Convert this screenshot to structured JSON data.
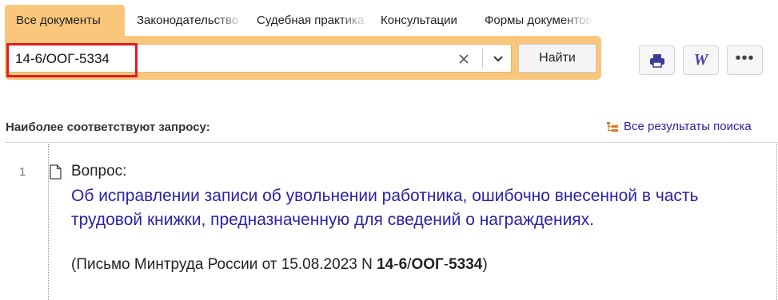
{
  "tabs": [
    {
      "label": "Все документы",
      "active": true
    },
    {
      "label": "Законодательство",
      "active": false
    },
    {
      "label": "Судебная практика",
      "active": false
    },
    {
      "label": "Консультации",
      "active": false
    },
    {
      "label": "Формы документов",
      "active": false
    }
  ],
  "search": {
    "value": "14-6/ООГ-5334",
    "find_label": "Найти"
  },
  "results": {
    "section_title": "Наиболее соответствуют запросу:",
    "all_results_label": "Все результаты поиска",
    "items": [
      {
        "number": "1",
        "kind": "Вопрос:",
        "title": "Об исправлении записи об увольнении работника, ошибочно внесенной в часть трудовой книжки, предназначенную для сведений о награждениях.",
        "source_prefix": "(Письмо Минтруда России от 15.08.2023 N ",
        "source_p1": "14",
        "source_sep1": "-",
        "source_p2": "6",
        "source_sep2": "/",
        "source_p3": "ООГ",
        "source_sep3": "-",
        "source_p4": "5334",
        "source_suffix": ")"
      }
    ]
  },
  "colors": {
    "accent": "#f9c77c",
    "link": "#2b22a8",
    "highlight": "#e11b22"
  },
  "icons": {
    "clear": "close-icon",
    "dropdown": "chevron-down-icon",
    "print": "printer-icon",
    "word": "word-export-icon",
    "more": "more-icon",
    "all_results": "tree-results-icon",
    "document": "document-icon"
  }
}
